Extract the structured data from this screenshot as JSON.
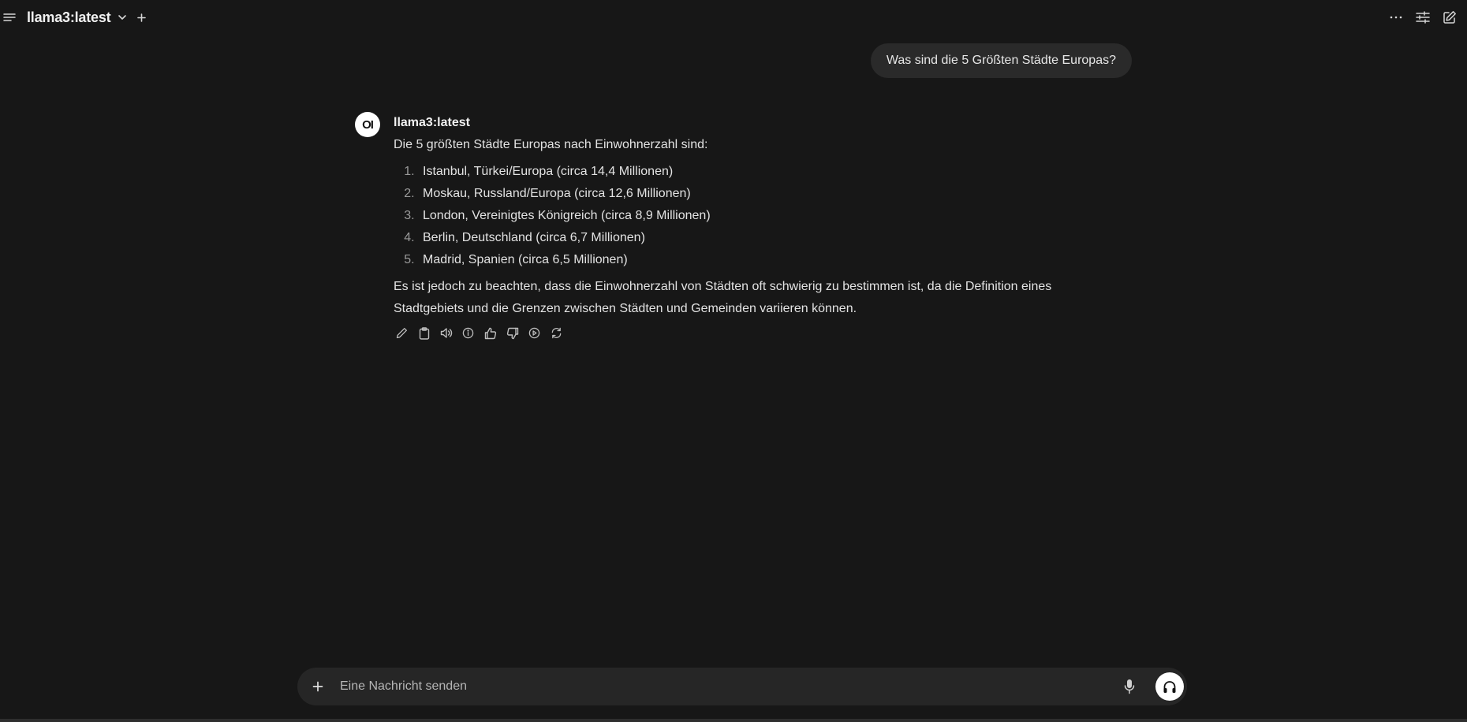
{
  "header": {
    "model_name": "llama3:latest"
  },
  "conversation": {
    "user_message": "Was sind die 5 Größten Städte Europas?",
    "assistant": {
      "avatar_text": "OI",
      "name": "llama3:latest",
      "intro": "Die 5 größten Städte Europas nach Einwohnerzahl sind:",
      "list": [
        "Istanbul, Türkei/Europa (circa 14,4 Millionen)",
        "Moskau, Russland/Europa (circa 12,6 Millionen)",
        "London, Vereinigtes Königreich (circa 8,9 Millionen)",
        "Berlin, Deutschland (circa 6,7 Millionen)",
        "Madrid, Spanien (circa 6,5 Millionen)"
      ],
      "note": "Es ist jedoch zu beachten, dass die Einwohnerzahl von Städten oft schwierig zu bestimmen ist, da die Definition eines Stadtgebiets und die Grenzen zwischen Städten und Gemeinden variieren können."
    }
  },
  "composer": {
    "placeholder": "Eine Nachricht senden",
    "value": ""
  },
  "icons": {
    "menu": "menu-icon",
    "chevron": "chevron-down-icon",
    "new_tab": "plus-icon",
    "more": "more-horizontal-icon",
    "controls": "sliders-icon",
    "new_chat": "edit-icon",
    "actions": [
      "pencil-icon",
      "clipboard-icon",
      "speaker-icon",
      "info-icon",
      "thumbs-up-icon",
      "thumbs-down-icon",
      "play-icon",
      "refresh-icon"
    ],
    "attach": "plus-icon",
    "mic": "microphone-icon",
    "voice": "headphones-icon"
  },
  "colors": {
    "background": "#171717",
    "bubble": "#2a2a2a",
    "composer": "#262626",
    "text": "#e3e3e3"
  }
}
